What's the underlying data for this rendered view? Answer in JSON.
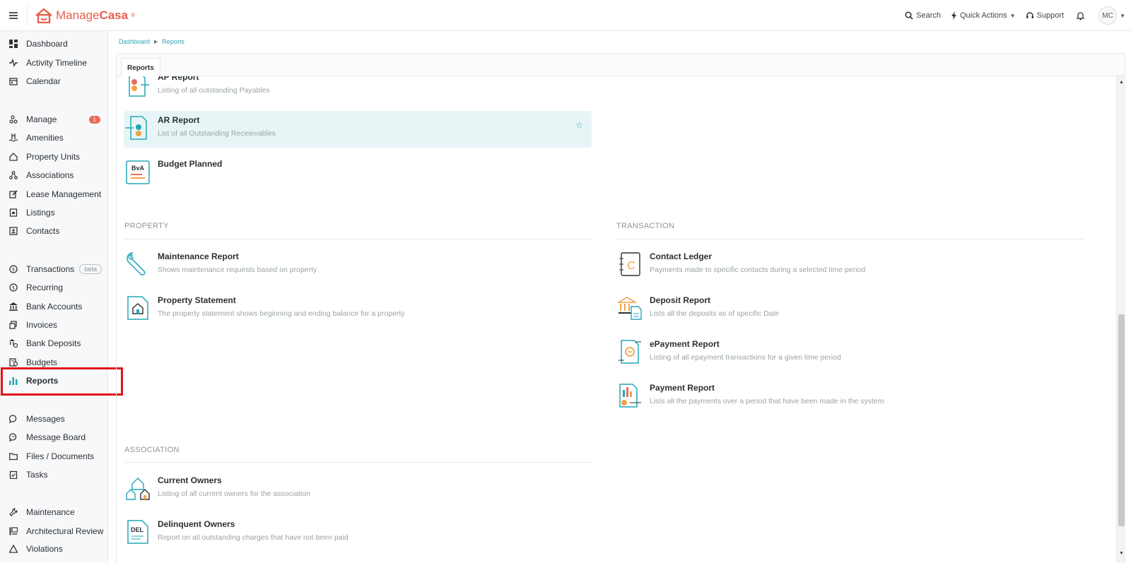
{
  "header": {
    "brand_prefix": "Manage",
    "brand_suffix": "Casa",
    "search_label": "Search",
    "quick_actions_label": "Quick Actions",
    "support_label": "Support",
    "avatar_initials": "MC",
    "brand_color": "#e8604c"
  },
  "sidebar": {
    "items": [
      {
        "label": "Dashboard",
        "icon": "dashboard-icon"
      },
      {
        "label": "Activity Timeline",
        "icon": "pulse-icon"
      },
      {
        "label": "Calendar",
        "icon": "calendar-icon"
      },
      {
        "label": "Manage",
        "icon": "manage-icon",
        "badge": "1"
      },
      {
        "label": "Amenities",
        "icon": "pool-icon"
      },
      {
        "label": "Property Units",
        "icon": "home-icon"
      },
      {
        "label": "Associations",
        "icon": "network-icon"
      },
      {
        "label": "Lease Management",
        "icon": "edit-icon"
      },
      {
        "label": "Listings",
        "icon": "listing-icon"
      },
      {
        "label": "Contacts",
        "icon": "contact-icon"
      },
      {
        "label": "Transactions",
        "icon": "dollar-icon",
        "tag": "beta"
      },
      {
        "label": "Recurring",
        "icon": "recurring-icon"
      },
      {
        "label": "Bank Accounts",
        "icon": "bank-icon"
      },
      {
        "label": "Invoices",
        "icon": "invoice-icon"
      },
      {
        "label": "Bank Deposits",
        "icon": "deposit-icon"
      },
      {
        "label": "Budgets",
        "icon": "budget-icon"
      },
      {
        "label": "Reports",
        "icon": "bar-chart-icon"
      },
      {
        "label": "Messages",
        "icon": "message-icon"
      },
      {
        "label": "Message Board",
        "icon": "message-board-icon"
      },
      {
        "label": "Files / Documents",
        "icon": "folder-icon"
      },
      {
        "label": "Tasks",
        "icon": "task-icon"
      },
      {
        "label": "Maintenance",
        "icon": "wrench-icon"
      },
      {
        "label": "Architectural Review",
        "icon": "review-icon"
      },
      {
        "label": "Violations",
        "icon": "warning-icon"
      }
    ]
  },
  "breadcrumb": [
    "Dashboard",
    "Reports"
  ],
  "tab_label": "Reports",
  "reports_top": [
    {
      "title": "AP Report",
      "desc": "Listing of all outstanding Payables"
    },
    {
      "title": "AR Report",
      "desc": "List of all Outstanding Receievables"
    },
    {
      "title": "Budget Planned",
      "desc": ""
    }
  ],
  "sections": {
    "property": {
      "title": "PROPERTY",
      "items": [
        {
          "title": "Maintenance Report",
          "desc": "Shows maintenance requests based on property"
        },
        {
          "title": "Property Statement",
          "desc": "The property statement shows beginning and ending balance for a property"
        }
      ]
    },
    "transaction": {
      "title": "TRANSACTION",
      "items": [
        {
          "title": "Contact Ledger",
          "desc": "Payments made to specific contacts during a selected time period"
        },
        {
          "title": "Deposit Report",
          "desc": "Lists all the deposits as of specific Date"
        },
        {
          "title": "ePayment Report",
          "desc": "Listing of all epayment transactions for a given time period"
        },
        {
          "title": "Payment Report",
          "desc": "Lists all the payments over a period that have been made in the system"
        }
      ]
    },
    "association": {
      "title": "ASSOCIATION",
      "items": [
        {
          "title": "Current Owners",
          "desc": "Listing of all current owners for the association"
        },
        {
          "title": "Delinquent Owners",
          "desc": "Report on all outstanding charges that have not been paid"
        }
      ]
    }
  },
  "icon_text": {
    "bva": "BvA",
    "del": "DEL",
    "ledger_letter": "C"
  },
  "accent_color": "#23a6b8"
}
